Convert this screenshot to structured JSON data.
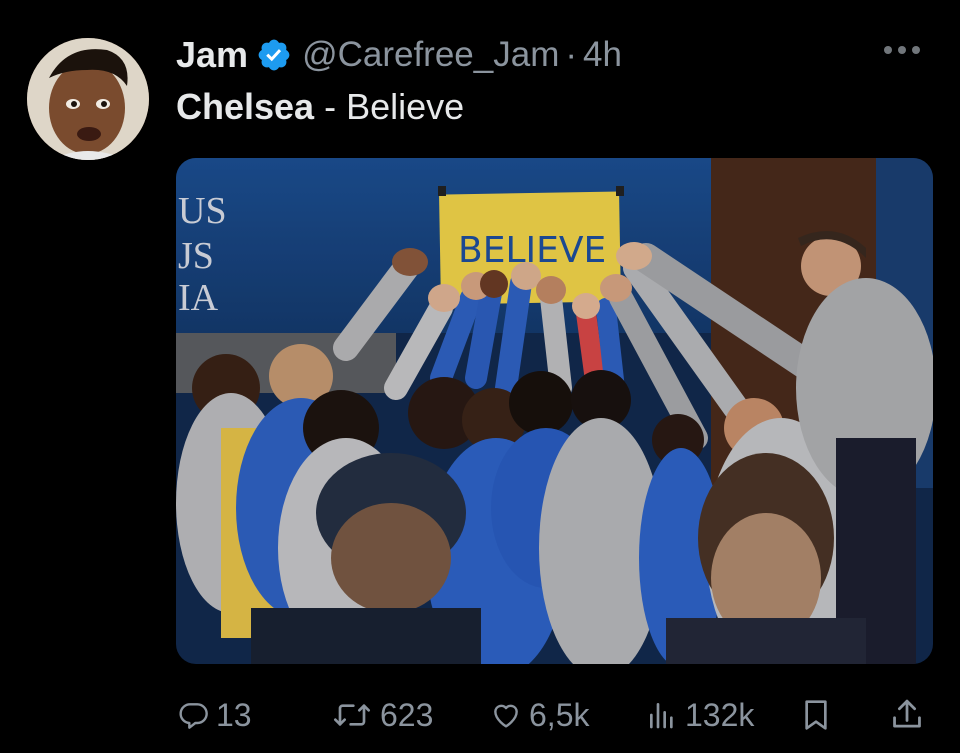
{
  "author": {
    "name": "Jam",
    "handle": "@Carefree_Jam",
    "separator": "·",
    "time": "4h",
    "verified_icon": "verified-badge-icon",
    "colors": {
      "verified": "#1d9bf0"
    }
  },
  "tweet": {
    "bold_text": "Chelsea",
    "text": " - Believe"
  },
  "media": {
    "sign_text": "BELIEVE",
    "wall_text": [
      "US",
      "JS",
      "IA"
    ]
  },
  "actions": {
    "replies": "13",
    "retweets": "623",
    "likes": "6,5k",
    "views": "132k"
  }
}
